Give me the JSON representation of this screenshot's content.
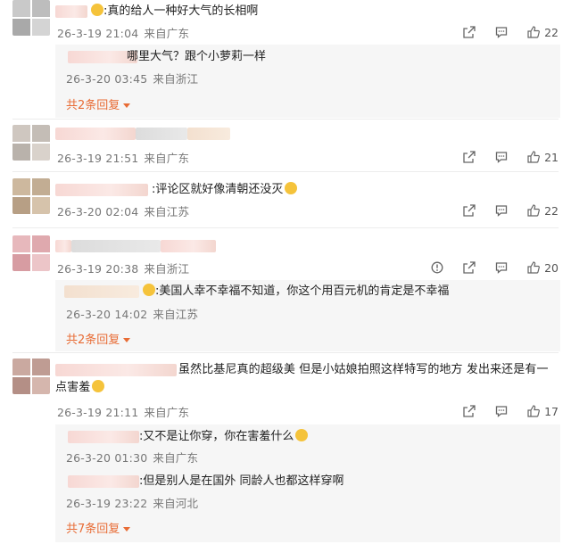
{
  "comments": [
    {
      "text": ":真的给人一种好大气的长相啊",
      "date": "26-3-19 21:04",
      "location": "来自广东",
      "likes": "22",
      "replies": [
        {
          "text": "哪里大气？跟个小萝莉一样",
          "date": "26-3-20 03:45",
          "location": "来自浙江"
        }
      ],
      "more": "共2条回复"
    },
    {
      "text": "",
      "date": "26-3-19 21:51",
      "location": "来自广东",
      "likes": "21"
    },
    {
      "text": ":评论区就好像清朝还没灭",
      "date": "26-3-20 02:04",
      "location": "来自江苏",
      "likes": "22"
    },
    {
      "text": "",
      "date": "26-3-19 20:38",
      "location": "来自浙江",
      "likes": "20",
      "replies": [
        {
          "text": ":美国人幸不幸福不知道，你这个用百元机的肯定是不幸福",
          "date": "26-3-20 14:02",
          "location": "来自江苏"
        }
      ],
      "more": "共2条回复"
    },
    {
      "text": "虽然比基尼真的超级美 但是小姑娘拍照这样特写的地方 发出来还是有一点害羞",
      "date": "26-3-19 21:11",
      "location": "来自广东",
      "likes": "17",
      "replies": [
        {
          "text": ":又不是让你穿，你在害羞什么",
          "date": "26-3-20 01:30",
          "location": "来自广东"
        },
        {
          "text": ":但是别人是在国外 同龄人也都这样穿啊",
          "date": "26-3-19 23:22",
          "location": "来自河北"
        }
      ],
      "more": "共7条回复"
    }
  ],
  "icons": [
    "share-icon",
    "comment-icon",
    "like-icon",
    "report-icon"
  ],
  "colors": {
    "accent": "#e86b34",
    "meta": "#777777"
  }
}
